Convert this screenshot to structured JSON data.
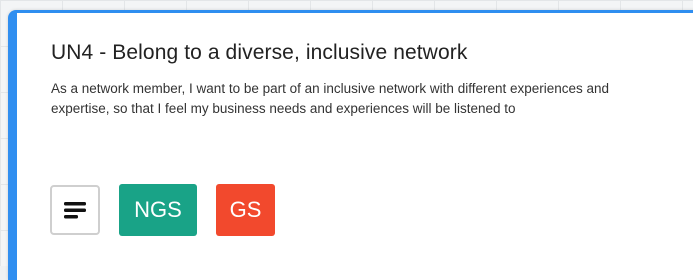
{
  "card": {
    "title": "UN4 - Belong to a diverse, inclusive network",
    "description": "As a network member, I want to be part of an inclusive network with different experiences and expertise, so that I feel my business needs and experiences will be listened to",
    "accent_color": "#2f8ef0"
  },
  "actions": {
    "menu_icon": "menu-lines-icon",
    "tags": [
      {
        "label": "NGS",
        "color": "#19a387"
      },
      {
        "label": "GS",
        "color": "#f2492d"
      }
    ]
  }
}
